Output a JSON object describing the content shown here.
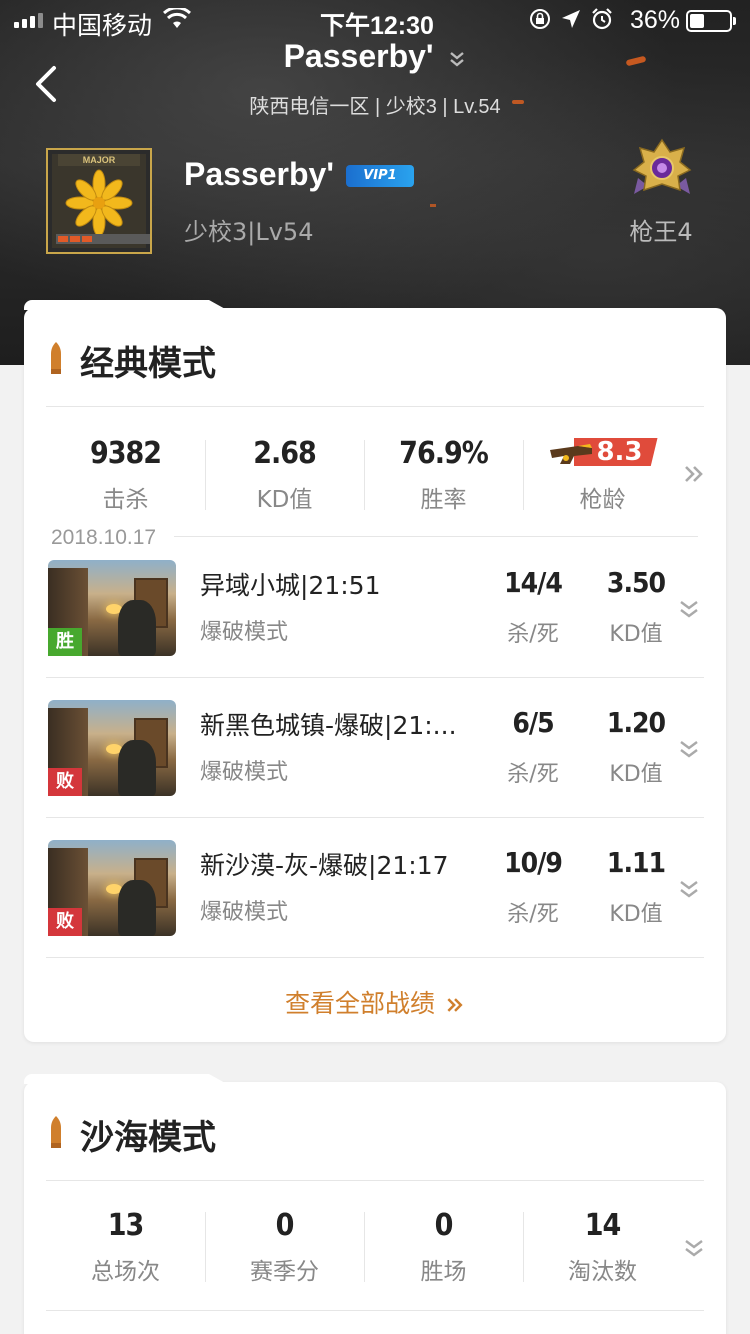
{
  "status_bar": {
    "carrier": "中国移动",
    "time": "下午12:30",
    "battery_pct": "36%",
    "battery_level": 0.36
  },
  "nav": {
    "title": "Passerby'",
    "subtitle": "陕西电信一区 | 少校3 | Lv.54"
  },
  "profile": {
    "avatar_text": "MAJOR",
    "name": "Passerby'",
    "vip": "VIP1",
    "rank": "少校3|Lv54",
    "rank_title": "枪王4"
  },
  "classic": {
    "title": "经典模式",
    "stats": [
      {
        "value": "9382",
        "label": "击杀"
      },
      {
        "value": "2.68",
        "label": "KD值"
      },
      {
        "value": "76.9%",
        "label": "胜率"
      },
      {
        "value": "8.3",
        "label": "枪龄"
      }
    ],
    "date": "2018.10.17",
    "matches": [
      {
        "result": "胜",
        "result_color": "#47a82e",
        "map": "异域小城|21:51",
        "mode": "爆破模式",
        "kd": "14/4",
        "kd_label": "杀/死",
        "ratio": "3.50",
        "ratio_label": "KD值"
      },
      {
        "result": "败",
        "result_color": "#d4363b",
        "map": "新黑色城镇-爆破|21:...",
        "mode": "爆破模式",
        "kd": "6/5",
        "kd_label": "杀/死",
        "ratio": "1.20",
        "ratio_label": "KD值"
      },
      {
        "result": "败",
        "result_color": "#d4363b",
        "map": "新沙漠-灰-爆破|21:17",
        "mode": "爆破模式",
        "kd": "10/9",
        "kd_label": "杀/死",
        "ratio": "1.11",
        "ratio_label": "KD值"
      }
    ],
    "view_all": "查看全部战绩"
  },
  "desert": {
    "title": "沙海模式",
    "stats": [
      {
        "value": "13",
        "label": "总场次"
      },
      {
        "value": "0",
        "label": "赛季分"
      },
      {
        "value": "0",
        "label": "胜场"
      },
      {
        "value": "14",
        "label": "淘汰数"
      }
    ]
  },
  "colors": {
    "accent": "#d07f2c",
    "win": "#47a82e",
    "lose": "#d4363b",
    "vip": "#1b6fcf"
  },
  "icons": [
    "back-arrow-icon",
    "chevron-down-icon",
    "bullet-icon",
    "double-chevron-right-icon",
    "double-chevron-down-icon",
    "gun-icon",
    "rank-emblem-icon",
    "wifi-icon",
    "alarm-icon",
    "location-icon",
    "lock-rotation-icon"
  ]
}
